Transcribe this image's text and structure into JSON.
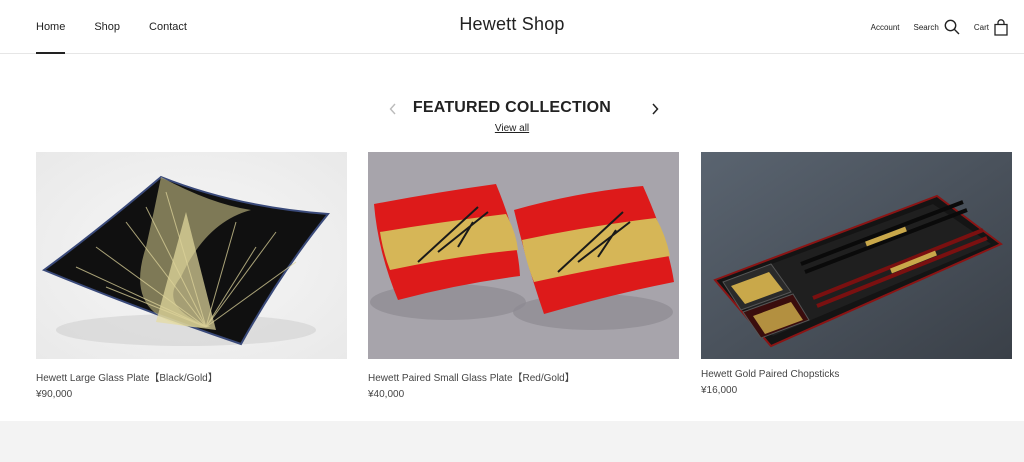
{
  "header": {
    "nav": [
      {
        "label": "Home",
        "active": true
      },
      {
        "label": "Shop",
        "active": false
      },
      {
        "label": "Contact",
        "active": false
      }
    ],
    "logo": "Hewett Shop",
    "account_label": "Account",
    "search_label": "Search",
    "cart_label": "Cart",
    "icons": {
      "search": "search-icon",
      "cart": "shopping-bag-icon"
    }
  },
  "featured": {
    "title": "FEATURED COLLECTION",
    "view_all": "View all",
    "icons": {
      "prev": "chevron-left-icon",
      "next": "chevron-right-icon"
    }
  },
  "products": [
    {
      "name": "Hewett Large Glass Plate【Black/Gold】",
      "price": "¥90,000"
    },
    {
      "name": "Hewett Paired Small Glass Plate【Red/Gold】",
      "price": "¥40,000"
    },
    {
      "name": "Hewett Gold Paired Chopsticks",
      "price": "¥16,000"
    }
  ],
  "colors": {
    "text": "#222222",
    "border": "#e6e6e6",
    "footer_bg": "#f3f3f3"
  }
}
